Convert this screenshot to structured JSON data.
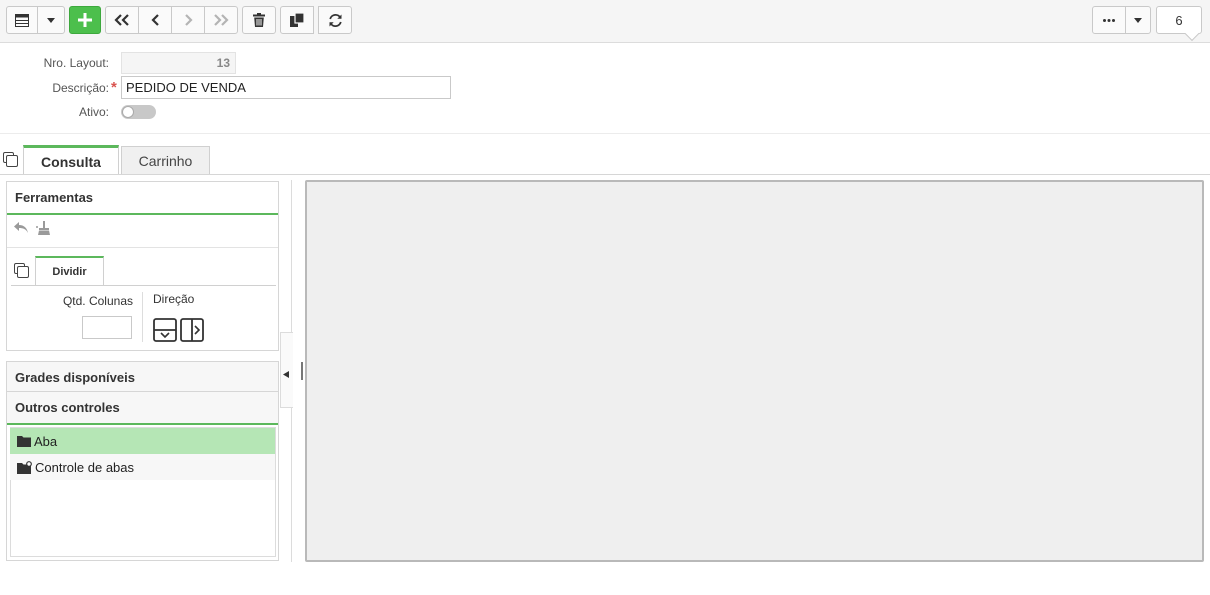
{
  "toolbar": {
    "buttons": [
      {
        "name": "grid-view-button",
        "icon": "grid-icon",
        "enabled": true
      },
      {
        "name": "view-dropdown-button",
        "icon": "caret-down-icon",
        "enabled": true
      },
      {
        "name": "add-button",
        "icon": "plus-icon",
        "enabled": true
      },
      {
        "name": "first-record-button",
        "icon": "double-chevron-left-icon",
        "enabled": true
      },
      {
        "name": "previous-record-button",
        "icon": "chevron-left-icon",
        "enabled": true
      },
      {
        "name": "next-record-button",
        "icon": "chevron-right-icon",
        "enabled": false
      },
      {
        "name": "last-record-button",
        "icon": "double-chevron-right-icon",
        "enabled": false
      },
      {
        "name": "delete-button",
        "icon": "trash-icon",
        "enabled": true
      },
      {
        "name": "duplicate-button",
        "icon": "copy-icon",
        "enabled": true
      },
      {
        "name": "refresh-button",
        "icon": "refresh-icon",
        "enabled": true
      },
      {
        "name": "more-options-button",
        "icon": "ellipsis-icon",
        "enabled": true
      },
      {
        "name": "more-dropdown-button",
        "icon": "caret-down-icon",
        "enabled": true
      }
    ],
    "record_count": "6"
  },
  "form": {
    "nro_layout_label": "Nro. Layout:",
    "nro_layout_value": "13",
    "descricao_label": "Descrição:",
    "required_mark": "*",
    "descricao_value": "PEDIDO DE VENDA",
    "ativo_label": "Ativo:",
    "ativo_on": false
  },
  "tabs": [
    {
      "label": "Consulta",
      "active": true
    },
    {
      "label": "Carrinho",
      "active": false
    }
  ],
  "tools_panel": {
    "title": "Ferramentas",
    "subtab": "Dividir",
    "qtd_colunas_label": "Qtd. Colunas",
    "qtd_colunas_value": "",
    "direcao_label": "Direção"
  },
  "grades_panel": {
    "title": "Grades disponíveis"
  },
  "outros_panel": {
    "title": "Outros controles",
    "items": [
      {
        "label": "Aba",
        "icon": "folder-icon",
        "selected": true
      },
      {
        "label": "Controle de abas",
        "icon": "folder-tabs-icon",
        "selected": false
      }
    ]
  },
  "colors": {
    "accent_green": "#5cb85c",
    "add_button_green": "#4cbf4c",
    "selected_row": "#b5e6b5",
    "stage_bg": "#efefef",
    "required_red": "#d9534f"
  }
}
